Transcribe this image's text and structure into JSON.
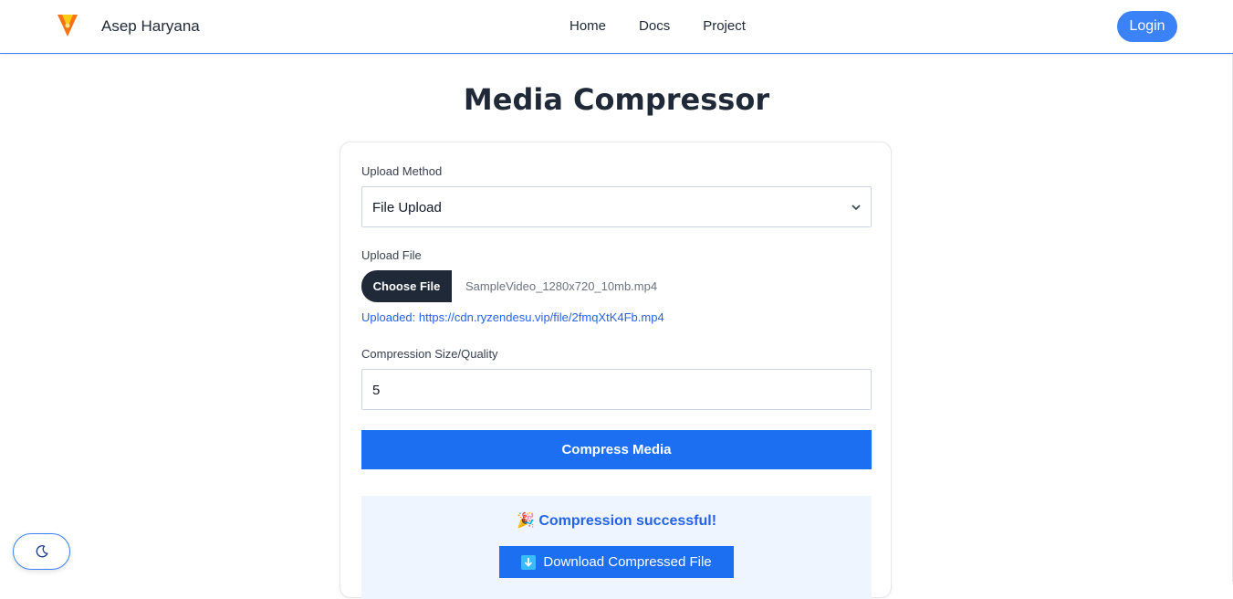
{
  "navbar": {
    "brand": "Asep Haryana",
    "links": [
      "Home",
      "Docs",
      "Project"
    ],
    "login_label": "Login",
    "logo_icon": "flame-shield-logo-icon"
  },
  "page": {
    "title": "Media Compressor"
  },
  "form": {
    "upload_method_label": "Upload Method",
    "upload_method_value": "File Upload",
    "upload_file_label": "Upload File",
    "choose_file_label": "Choose File",
    "selected_filename": "SampleVideo_1280x720_10mb.mp4",
    "uploaded_text": "Uploaded: https://cdn.ryzendesu.vip/file/2fmqXtK4Fb.mp4",
    "compression_label": "Compression Size/Quality",
    "compression_value": "5",
    "compress_button": "Compress Media"
  },
  "result": {
    "message": "🎉 Compression successful!",
    "download_label": "Download Compressed File"
  },
  "theme_toggle": {
    "icon": "moon-icon"
  },
  "colors": {
    "accent": "#3b82f6",
    "primary_button": "#1d6ff2",
    "dark_button": "#1f2937"
  }
}
